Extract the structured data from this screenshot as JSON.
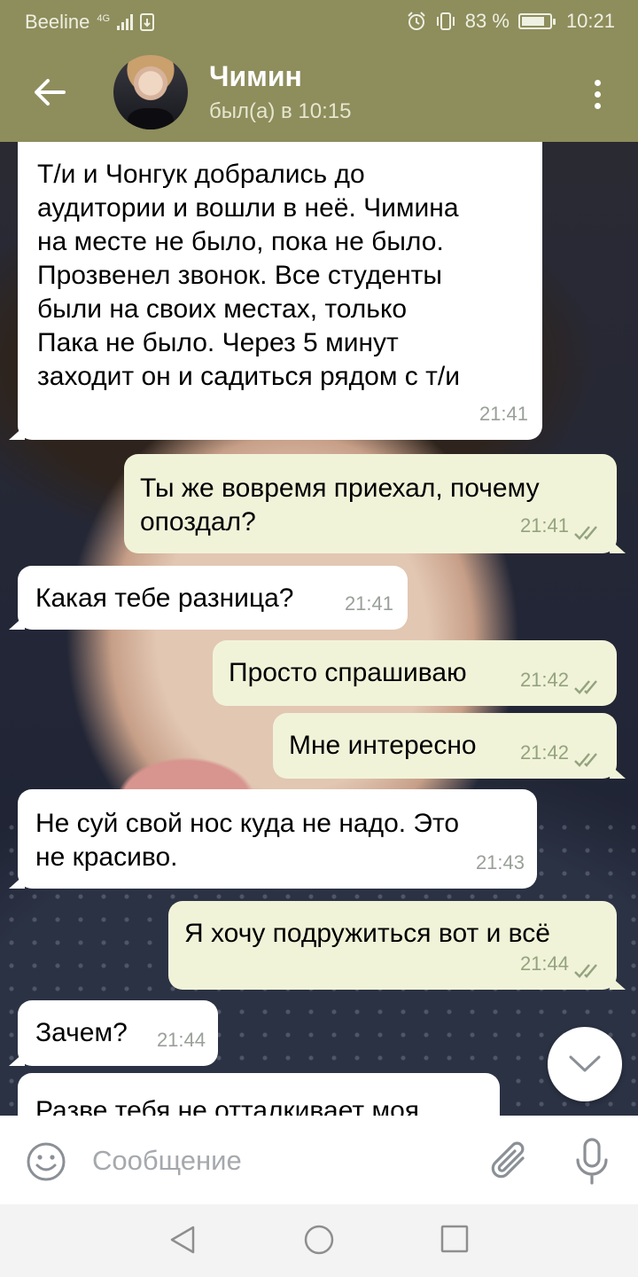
{
  "status_bar": {
    "carrier": "Beeline",
    "network": "4G",
    "battery": "83 %",
    "battery_level": 0.83,
    "time": "10:21"
  },
  "header": {
    "contact_name": "Чимин",
    "contact_status": "был(а) в 10:15"
  },
  "messages": [
    {
      "direction": "in",
      "text": "Т/и и Чонгук добрались до\nаудитории и вошли в неё. Чимина\nна месте не было, пока не было.\nПрозвенел звонок. Все студенты\nбыли на своих местах, только\nПака не было. Через 5 минут\nзаходит он и садиться рядом с т/и",
      "time": "21:41"
    },
    {
      "direction": "out",
      "text": "Ты же вовремя приехал, почему\nопоздал?",
      "time": "21:41",
      "read": true
    },
    {
      "direction": "in",
      "text": "Какая тебе разница?",
      "time": "21:41"
    },
    {
      "direction": "out",
      "text": "Просто спрашиваю",
      "time": "21:42",
      "read": true
    },
    {
      "direction": "out",
      "text": "Мне интересно",
      "time": "21:42",
      "read": true
    },
    {
      "direction": "in",
      "text": "Не суй свой нос куда не надо. Это\nне красиво.",
      "time": "21:43"
    },
    {
      "direction": "out",
      "text": "Я хочу подружиться вот и всё",
      "time": "21:44",
      "read": true
    },
    {
      "direction": "in",
      "text": "Зачем?",
      "time": "21:44"
    },
    {
      "direction": "in",
      "text": "Разве тебя не отталкивает моя",
      "time": ""
    }
  ],
  "input": {
    "placeholder": "Сообщение"
  },
  "icons": {
    "back": "arrow-left-icon",
    "menu": "more-vertical-icon",
    "scroll_down": "chevron-down-icon",
    "emoji": "smiley-icon",
    "attach": "paperclip-icon",
    "mic": "microphone-icon",
    "read_receipt": "double-check-icon"
  },
  "colors": {
    "header": "#8e8d5c",
    "incoming_bubble": "#ffffff",
    "outgoing_bubble": "#f1f3d9",
    "read_ticks": "#93a37f"
  }
}
